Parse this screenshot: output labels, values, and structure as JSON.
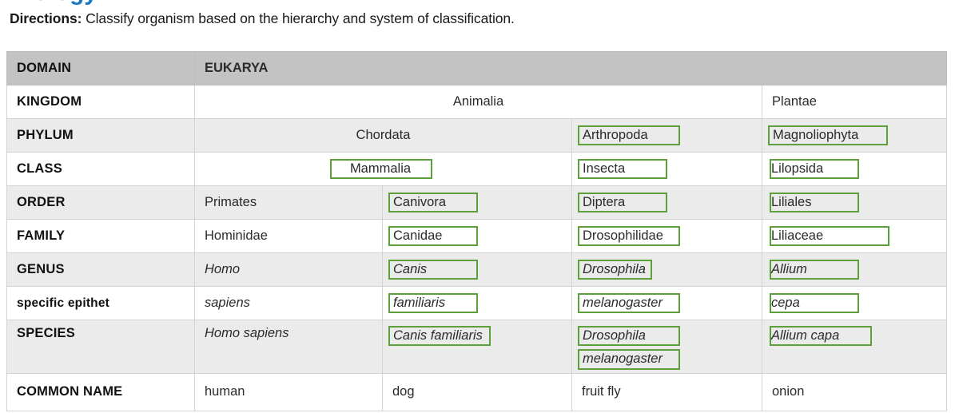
{
  "title_fragment": "Biology",
  "directions": {
    "lead": "Directions:",
    "text": " Classify organism based on the hierarchy and system of classification."
  },
  "colors": {
    "header_bg": "#c3c3c3",
    "stripe_bg": "#ebebeb",
    "annotation_green": "#5d9f3b",
    "title_blue": "#1779c4",
    "border": "#d3d3d3"
  },
  "table": {
    "rows": [
      {
        "rank": "DOMAIN",
        "kind": "header",
        "cells": [
          {
            "text": "EUKARYA",
            "span": 4,
            "bold": true
          }
        ]
      },
      {
        "rank": "KINGDOM",
        "kind": "plain",
        "cells": [
          {
            "text": "Animalia",
            "span": 3,
            "align": "center"
          },
          {
            "text": "Plantae",
            "span": 1
          }
        ]
      },
      {
        "rank": "PHYLUM",
        "kind": "shade",
        "cells": [
          {
            "text": "Chordata",
            "span": 2,
            "align": "center"
          },
          {
            "text": "Arthropoda",
            "span": 1,
            "boxed": true,
            "width": "md"
          },
          {
            "text": "Magnoliophyta",
            "span": 1,
            "boxed": true,
            "width": "lg"
          }
        ]
      },
      {
        "rank": "CLASS",
        "kind": "plain",
        "cells": [
          {
            "text": "Mammalia",
            "span": 2,
            "align": "center",
            "boxed": true,
            "width": "md"
          },
          {
            "text": "Insecta",
            "span": 1,
            "boxed": true,
            "width": "sm"
          },
          {
            "text": "Lilopsida",
            "span": 1,
            "boxed": true,
            "width": "sm",
            "clip": true
          }
        ]
      },
      {
        "rank": "ORDER",
        "kind": "shade",
        "cells": [
          {
            "text": "Primates",
            "span": 1
          },
          {
            "text": "Canivora",
            "span": 1,
            "boxed": true,
            "width": "sm"
          },
          {
            "text": "Diptera",
            "span": 1,
            "boxed": true,
            "width": "sm"
          },
          {
            "text": "Liliales",
            "span": 1,
            "boxed": true,
            "width": "sm",
            "clip": true
          }
        ]
      },
      {
        "rank": "FAMILY",
        "kind": "plain",
        "cells": [
          {
            "text": "Hominidae",
            "span": 1
          },
          {
            "text": "Canidae",
            "span": 1,
            "boxed": true,
            "width": "sm"
          },
          {
            "text": "Drosophilidae",
            "span": 1,
            "boxed": true,
            "width": "md"
          },
          {
            "text": "Liliaceae",
            "span": 1,
            "boxed": true,
            "width": "lg",
            "clip": true
          }
        ]
      },
      {
        "rank": "GENUS",
        "kind": "shade",
        "italic": true,
        "cells": [
          {
            "text": "Homo",
            "span": 1,
            "italic": true
          },
          {
            "text": "Canis",
            "span": 1,
            "italic": true,
            "boxed": true,
            "width": "sm"
          },
          {
            "text": "Drosophila",
            "span": 1,
            "italic": true,
            "boxed": true,
            "width": "xs"
          },
          {
            "text": "Allium",
            "span": 1,
            "italic": true,
            "boxed": true,
            "width": "sm",
            "clip": true
          }
        ]
      },
      {
        "rank": "specific epithet",
        "kind": "plain",
        "rank_small": true,
        "cells": [
          {
            "text": "sapiens",
            "span": 1,
            "italic": true
          },
          {
            "text": "familiaris",
            "span": 1,
            "italic": true,
            "boxed": true,
            "width": "sm"
          },
          {
            "text": "melanogaster",
            "span": 1,
            "italic": true,
            "boxed": true,
            "width": "md"
          },
          {
            "text": "cepa",
            "span": 1,
            "italic": true,
            "boxed": true,
            "width": "sm",
            "clip": true
          }
        ]
      },
      {
        "rank": "SPECIES",
        "kind": "shade",
        "tall": true,
        "cells": [
          {
            "text": "Homo sapiens",
            "span": 1,
            "italic": true
          },
          {
            "text": "Canis familiaris",
            "span": 1,
            "italic": true,
            "boxed": true,
            "width": "md"
          },
          {
            "lines": [
              "Drosophila",
              "melanogaster"
            ],
            "span": 1,
            "italic": true,
            "boxed": true,
            "width": "md"
          },
          {
            "text": "Allium capa",
            "span": 1,
            "italic": true,
            "boxed": true,
            "width": "md",
            "clip": true
          }
        ]
      },
      {
        "rank": "COMMON NAME",
        "kind": "plain",
        "common": true,
        "cells": [
          {
            "text": "human",
            "span": 1
          },
          {
            "text": "dog",
            "span": 1
          },
          {
            "text": "fruit fly",
            "span": 1
          },
          {
            "text": "onion",
            "span": 1
          }
        ]
      }
    ]
  }
}
